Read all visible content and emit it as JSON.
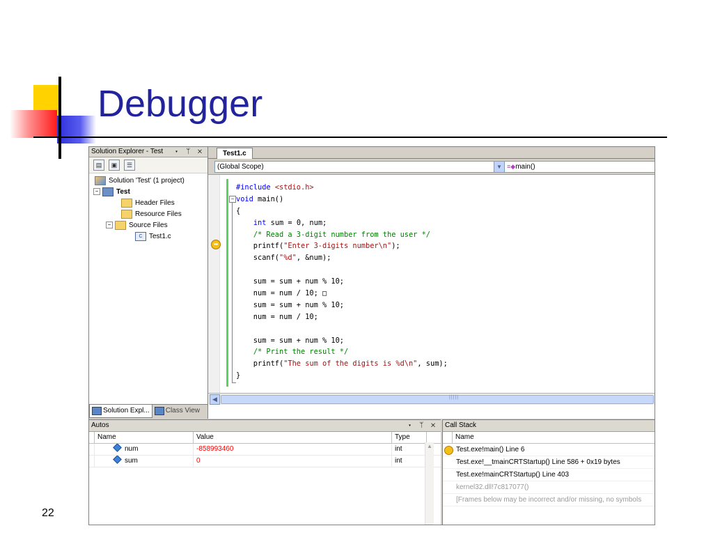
{
  "slide": {
    "title": "Debugger",
    "slide_number": "22"
  },
  "solution_explorer": {
    "title": "Solution Explorer - Test",
    "window_buttons": "▾ ᛘ ✕",
    "tree": {
      "solution": "Solution 'Test' (1 project)",
      "project": "Test",
      "header_files": "Header Files",
      "resource_files": "Resource Files",
      "source_files": "Source Files",
      "file": "Test1.c"
    },
    "tabs": [
      "Solution Expl...",
      "Class View"
    ]
  },
  "editor": {
    "tab": "Test1.c",
    "scope": "(Global Scope)",
    "member": "main()",
    "code_lines": [
      "#include <stdio.h>",
      "void main()",
      "{",
      "    int sum = 0, num;",
      "    /* Read a 3-digit number from the user */",
      "    printf(\"Enter 3-digits number\\n\");",
      "    scanf(\"%d\", &num);",
      "",
      "    sum = sum + num % 10;",
      "    num = num / 10; □",
      "    sum = sum + num % 10;",
      "    num = num / 10;",
      "",
      "    sum = sum + num % 10;",
      "    /* Print the result */",
      "    printf(\"The sum of the digits is %d\\n\", sum);",
      "}"
    ],
    "current_line": 6
  },
  "autos": {
    "title": "Autos",
    "window_buttons": "▾ ᛘ ✕",
    "columns": [
      "Name",
      "Value",
      "Type"
    ],
    "rows": [
      {
        "name": "num",
        "value": "-858993460",
        "type": "int"
      },
      {
        "name": "sum",
        "value": "0",
        "type": "int"
      }
    ]
  },
  "call_stack": {
    "title": "Call Stack",
    "column": "Name",
    "frames": [
      {
        "text": "Test.exe!main()  Line 6",
        "current": true,
        "grey": false
      },
      {
        "text": "Test.exe!__tmainCRTStartup()  Line 586 + 0x19 bytes",
        "current": false,
        "grey": false
      },
      {
        "text": "Test.exe!mainCRTStartup()  Line 403",
        "current": false,
        "grey": false
      },
      {
        "text": "kernel32.dll!7c817077()",
        "current": false,
        "grey": true
      },
      {
        "text": "[Frames below may be incorrect and/or missing, no symbols",
        "current": false,
        "grey": true
      }
    ]
  },
  "colors": {
    "title": "#23239c",
    "keyword": "#0000ff",
    "string": "#a31515",
    "comment": "#008000",
    "error_value": "#ff0000"
  }
}
